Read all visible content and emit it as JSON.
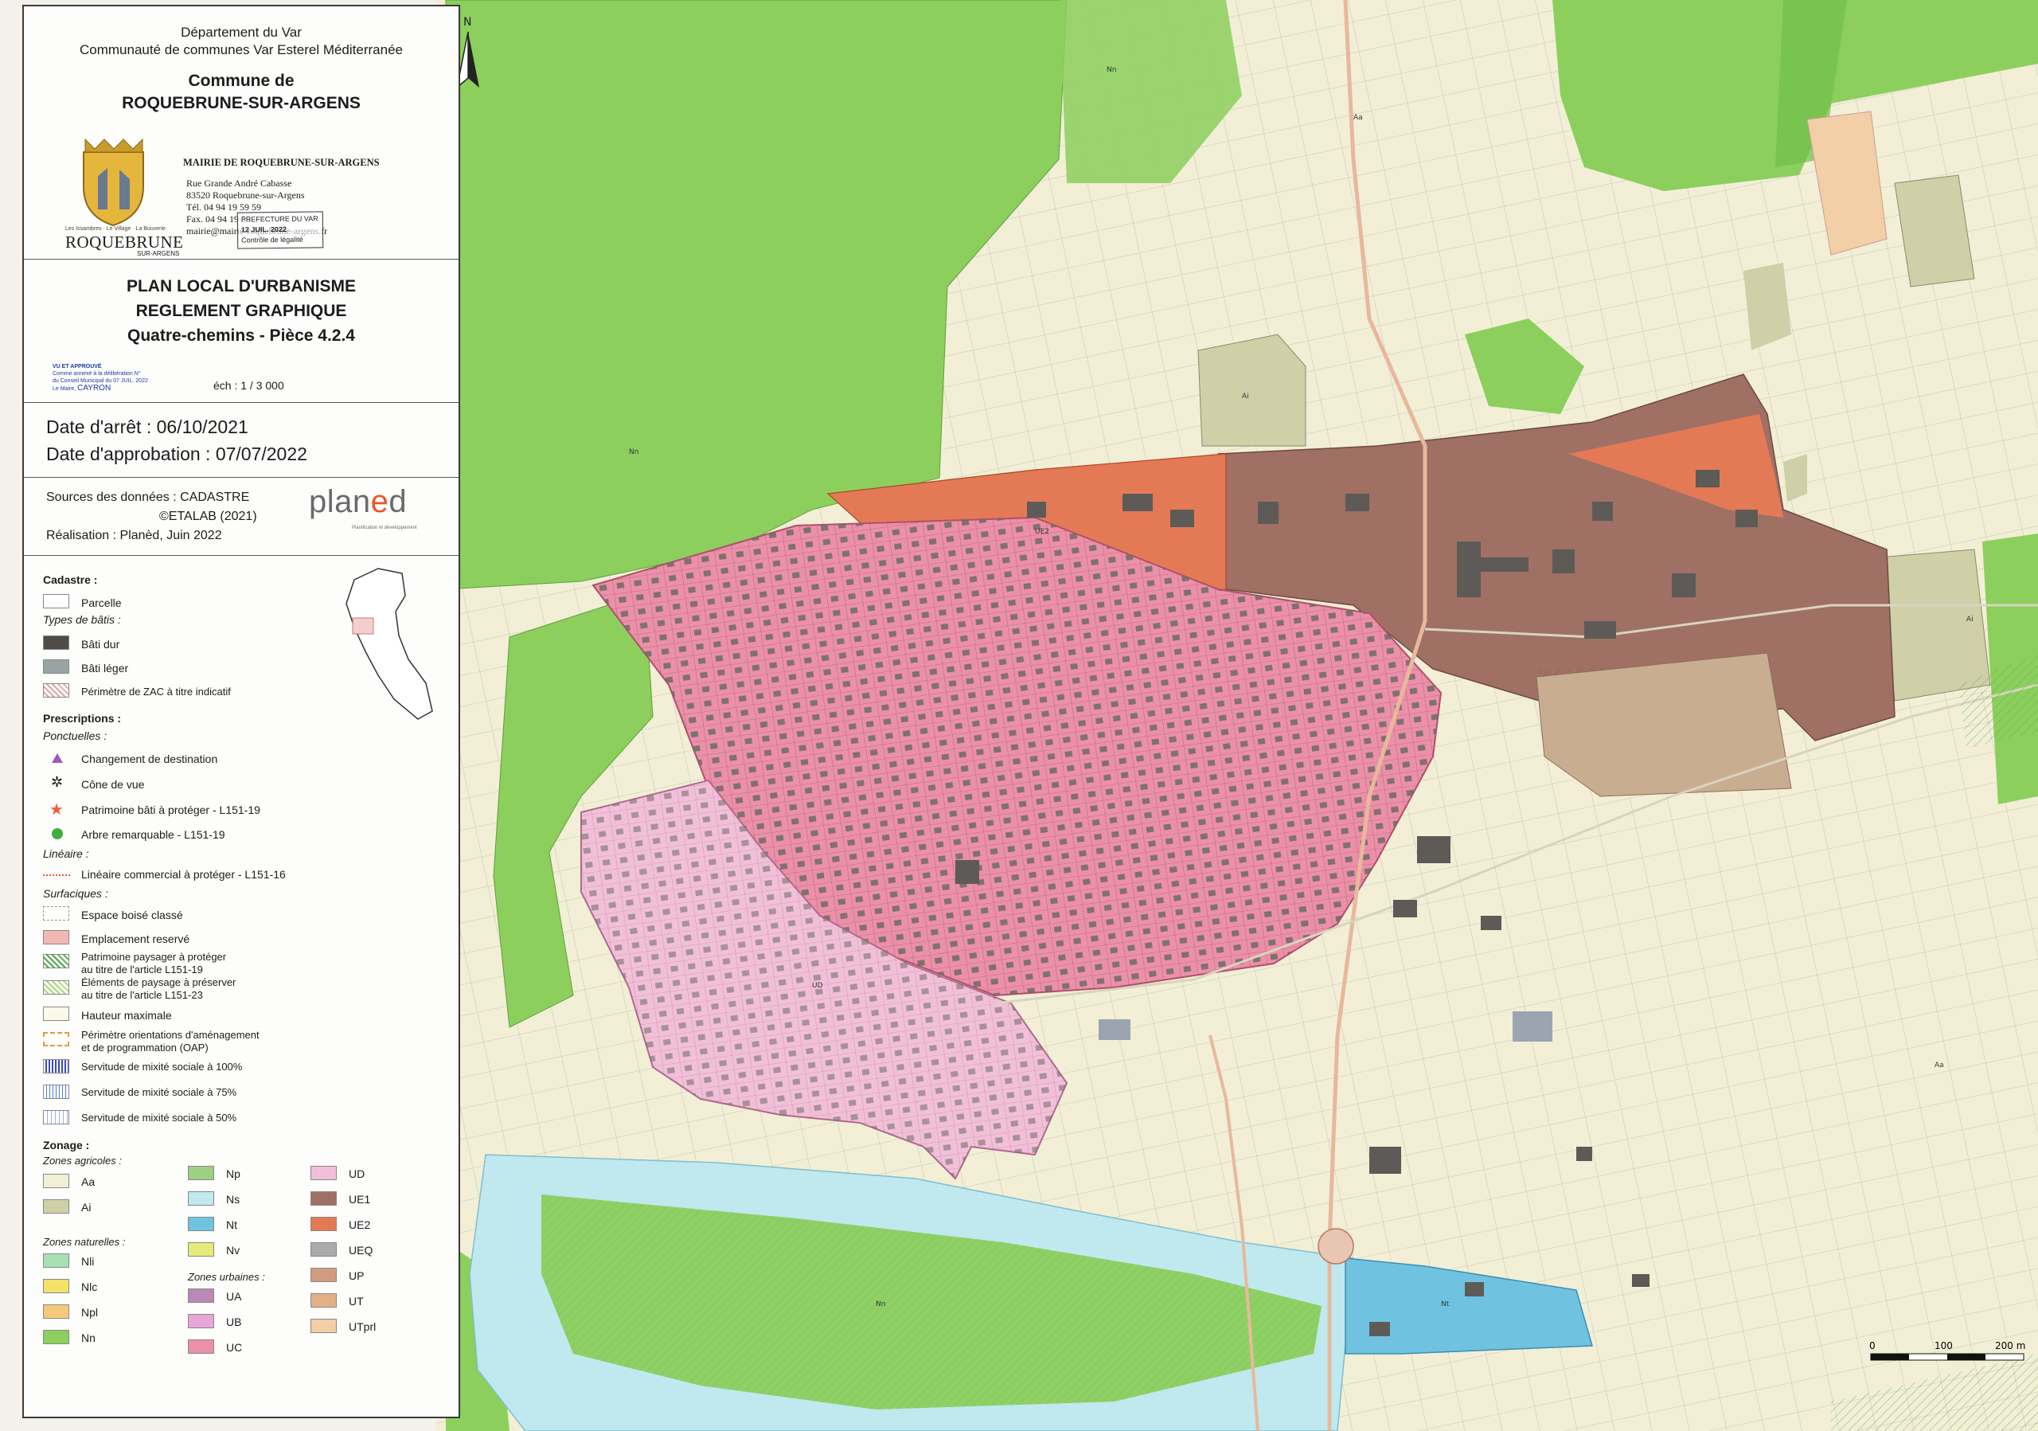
{
  "header": {
    "department": "Département du Var",
    "communaute": "Communauté de communes Var Esterel Méditerranée",
    "commune_label": "Commune de",
    "commune_name": "ROQUEBRUNE-SUR-ARGENS"
  },
  "mairie": {
    "logo_text": "ROQUEBRUNE",
    "logo_sub": "SUR-ARGENS",
    "logo_top": "Les Issambres · Le Village · La Bouverie",
    "title": "MAIRIE DE ROQUEBRUNE-SUR-ARGENS",
    "address1": "Rue Grande André Cabasse",
    "address2": "83520 Roquebrune-sur-Argens",
    "tel": "Tél. 04 94 19 59 59",
    "fax": "Fax. 04 94 19 59",
    "email": "mairie@mairie-roquebrune-argens.fr"
  },
  "stamp_prefecture": {
    "line1": "PREFECTURE DU VAR",
    "line2": "12 JUIL. 2022",
    "line3": "Contrôle de légalité"
  },
  "plu": {
    "line1": "PLAN LOCAL D'URBANISME",
    "line2": "REGLEMENT GRAPHIQUE",
    "line3": "Quatre-chemins - Pièce 4.2.4"
  },
  "approval_stamp": {
    "line1": "VU ET APPROUVÉ",
    "line2": "Comme annexé à la délibération N°",
    "line3": "du Conseil Municipal du 07 JUIL. 2022",
    "line4": "Le Maire,",
    "signature": "CAYRON"
  },
  "scale": "éch : 1 / 3 000",
  "dates": {
    "arret": "Date d'arrêt : 06/10/2021",
    "approbation": "Date d'approbation : 07/07/2022"
  },
  "sources": {
    "line1": "Sources des données : CADASTRE",
    "line2": "©ETALAB (2021)",
    "line3": "Réalisation : Planèd, Juin 2022",
    "brand_a": "plan",
    "brand_b": "e",
    "brand_c": "d",
    "brand_sub": "Planification et développement"
  },
  "legend": {
    "cadastre_title": "Cadastre :",
    "parcelle": "Parcelle",
    "types_bati": "Types de bâtis :",
    "bati_dur": "Bâti dur",
    "bati_leger": "Bâti léger",
    "zac": "Périmètre de ZAC à titre indicatif",
    "prescriptions": "Prescriptions :",
    "ponctuelles": "Ponctuelles :",
    "changement": "Changement de destination",
    "cone": "Cône de vue",
    "patrimoine_bati": "Patrimoine bâti à protéger - L151-19",
    "arbre": "Arbre remarquable - L151-19",
    "lineaire_title": "Linéaire :",
    "lineaire": "Linéaire commercial à protéger - L151-16",
    "surfaciques": "Surfaciques :",
    "ebc": "Espace boisé classé",
    "emplacement": "Emplacement reservé",
    "paysager1": "Patrimoine paysager à protéger",
    "paysager2": "au titre de l'article L151-19",
    "elements1": "Éléments de paysage à préserver",
    "elements2": "au titre de l'article L151-23",
    "hauteur": "Hauteur maximale",
    "oap1": "Périmètre orientations d'aménagement",
    "oap2": "et de programmation (OAP)",
    "mixite100": "Servitude de mixité sociale à 100%",
    "mixite75": "Servitude de mixité sociale à 75%",
    "mixite50": "Servitude de mixité sociale à 50%",
    "zonage": "Zonage :",
    "zones_agricoles": "Zones agricoles :",
    "zones_naturelles": "Zones naturelles :",
    "zones_urbaines": "Zones urbaines :"
  },
  "zones": {
    "Aa": "#f2efd6",
    "Ai": "#cfcfa8",
    "Nli": "#a8e0b4",
    "Nlc": "#f3e36a",
    "Npl": "#f5c97a",
    "Nn": "#8ccf5d",
    "Np": "#9fcf83",
    "Ns": "#bfe9ef",
    "Nt": "#6fc3e0",
    "Nv": "#e6ea79",
    "UA": "#b88ab5",
    "UB": "#e8a6d8",
    "UC": "#ec8fa8",
    "UD": "#f2bfd8",
    "UE1": "#a07065",
    "UE2": "#e47a55",
    "UEQ": "#aaaaaa",
    "UP": "#d39a82",
    "UT": "#e3b085",
    "UTprl": "#f2cfa6"
  },
  "map_labels": {
    "north": "N",
    "scale_0": "0",
    "scale_100": "100",
    "scale_200": "200 m"
  },
  "icons": [
    "crest-icon",
    "north-arrow-icon",
    "triangle-icon",
    "asterisk-icon",
    "star-icon",
    "dot-icon"
  ]
}
